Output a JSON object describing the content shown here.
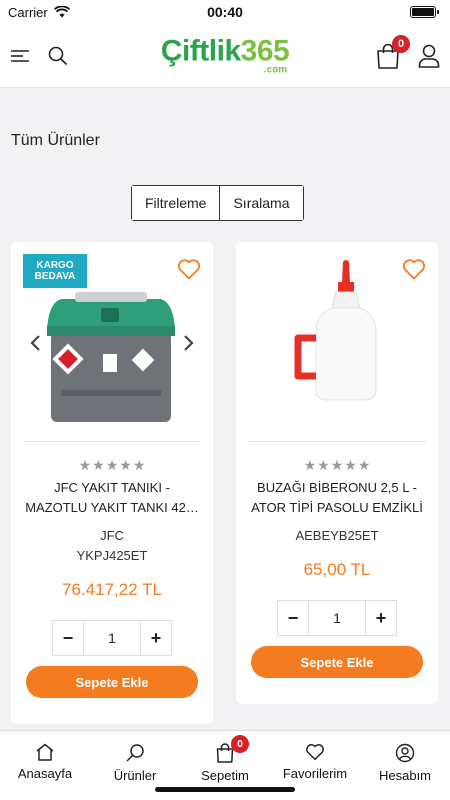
{
  "status_bar": {
    "carrier": "Carrier",
    "time": "00:40"
  },
  "header": {
    "logo_part1": "Çiftlik",
    "logo_part2": "365",
    "logo_suffix": ".com",
    "cart_count": "0",
    "icons": [
      "menu-icon",
      "search-icon",
      "shopping-bag-icon",
      "user-icon"
    ]
  },
  "page": {
    "title": "Tüm Ürünler",
    "filter_label": "Filtreleme",
    "sort_label": "Sıralama"
  },
  "products": [
    {
      "badge": "KARGO BEDAVA",
      "name_line1": "JFC YAKIT TANIKI -",
      "name_line2": "MAZOTLU YAKIT TANKI 42…",
      "brand": "JFC",
      "sku": "YKPJ425ET",
      "price": "76.417,22 TL",
      "rating_stars": 0,
      "quantity": "1",
      "add_label": "Sepete Ekle"
    },
    {
      "name_line1": "BUZAĞI BİBERONU 2,5 L -",
      "name_line2": "ATOR TİPİ PASOLU EMZİKLİ",
      "sku": "AEBEYB25ET",
      "price": "65,00 TL",
      "rating_stars": 0,
      "quantity": "1",
      "add_label": "Sepete Ekle"
    }
  ],
  "tabbar": {
    "items": [
      {
        "label": "Anasayfa",
        "icon": "home-icon"
      },
      {
        "label": "Ürünler",
        "icon": "search-icon"
      },
      {
        "label": "Sepetim",
        "icon": "shopping-bag-icon",
        "badge": "0"
      },
      {
        "label": "Favorilerim",
        "icon": "heart-icon"
      },
      {
        "label": "Hesabım",
        "icon": "user-circle-icon"
      }
    ]
  },
  "colors": {
    "accent": "#f47b20",
    "brand_dark": "#2aa34a",
    "brand_light": "#7ac143",
    "badge_red": "#d6202a",
    "kargo_blue": "#1fa9c2"
  }
}
